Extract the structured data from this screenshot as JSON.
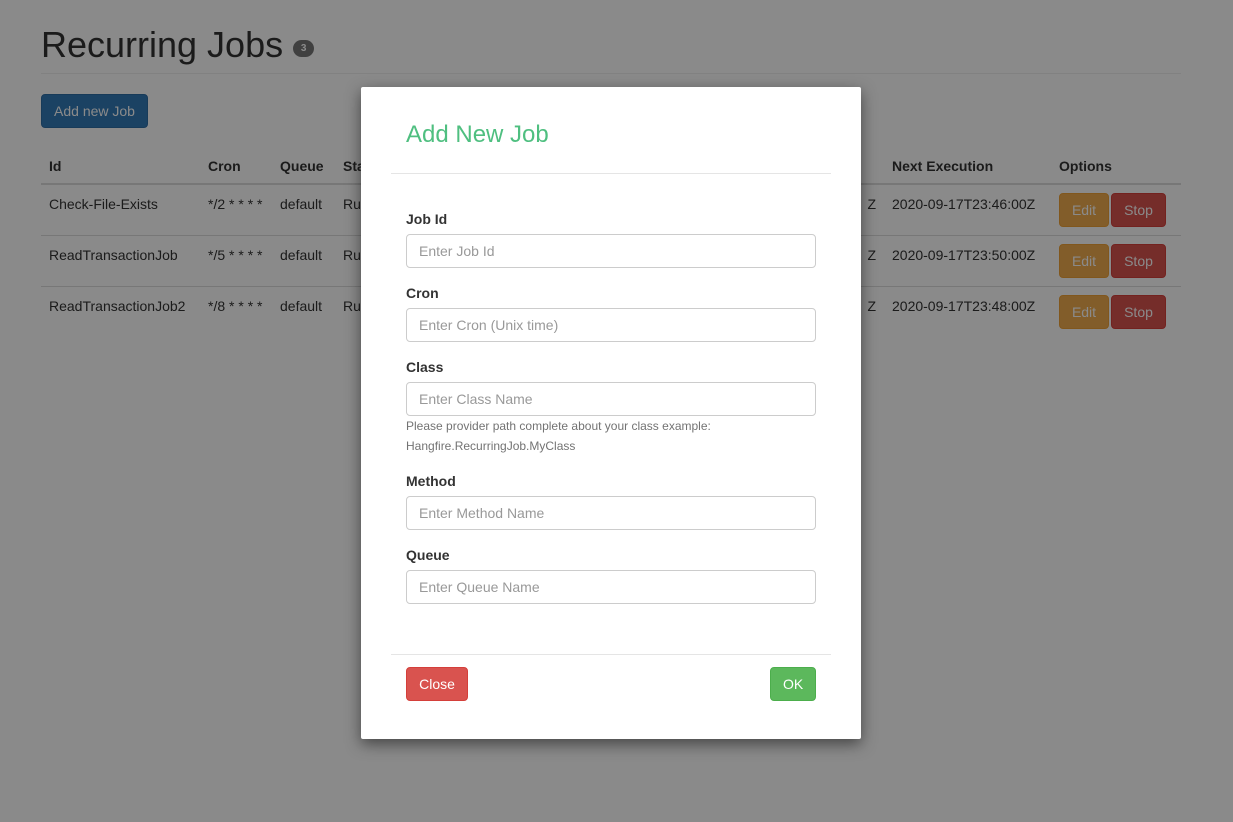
{
  "page": {
    "title": "Recurring Jobs",
    "count": "3",
    "add_button": "Add new Job"
  },
  "table": {
    "headers": [
      "Id",
      "Cron",
      "Queue",
      "Sta",
      "",
      "Next Execution",
      "Options"
    ],
    "rows": [
      {
        "id": "Check-File-Exists",
        "cron": "*/2 * * * *",
        "queue": "default",
        "status": "Ru",
        "last": "Z",
        "next": "2020-09-17T23:46:00Z"
      },
      {
        "id": "ReadTransactionJob",
        "cron": "*/5 * * * *",
        "queue": "default",
        "status": "Ru",
        "last": "Z",
        "next": "2020-09-17T23:50:00Z"
      },
      {
        "id": "ReadTransactionJob2",
        "cron": "*/8 * * * *",
        "queue": "default",
        "status": "Ru",
        "last": "Z",
        "next": "2020-09-17T23:48:00Z"
      }
    ],
    "edit_label": "Edit",
    "stop_label": "Stop"
  },
  "modal": {
    "title": "Add New Job",
    "fields": [
      {
        "label": "Job Id",
        "placeholder": "Enter Job Id"
      },
      {
        "label": "Cron",
        "placeholder": "Enter Cron (Unix time)"
      },
      {
        "label": "Class",
        "placeholder": "Enter Class Name"
      },
      {
        "label": "Method",
        "placeholder": "Enter Method Name"
      },
      {
        "label": "Queue",
        "placeholder": "Enter Queue Name"
      }
    ],
    "class_help_1": "Please provider path complete about your class example:",
    "class_help_2": "Hangfire.RecurringJob.MyClass",
    "close_label": "Close",
    "ok_label": "OK"
  },
  "colors": {
    "primary": "#337ab7",
    "title_green": "#4fbf80",
    "danger": "#d9534f",
    "warning": "#f0ad4e",
    "success": "#5cb85c"
  }
}
